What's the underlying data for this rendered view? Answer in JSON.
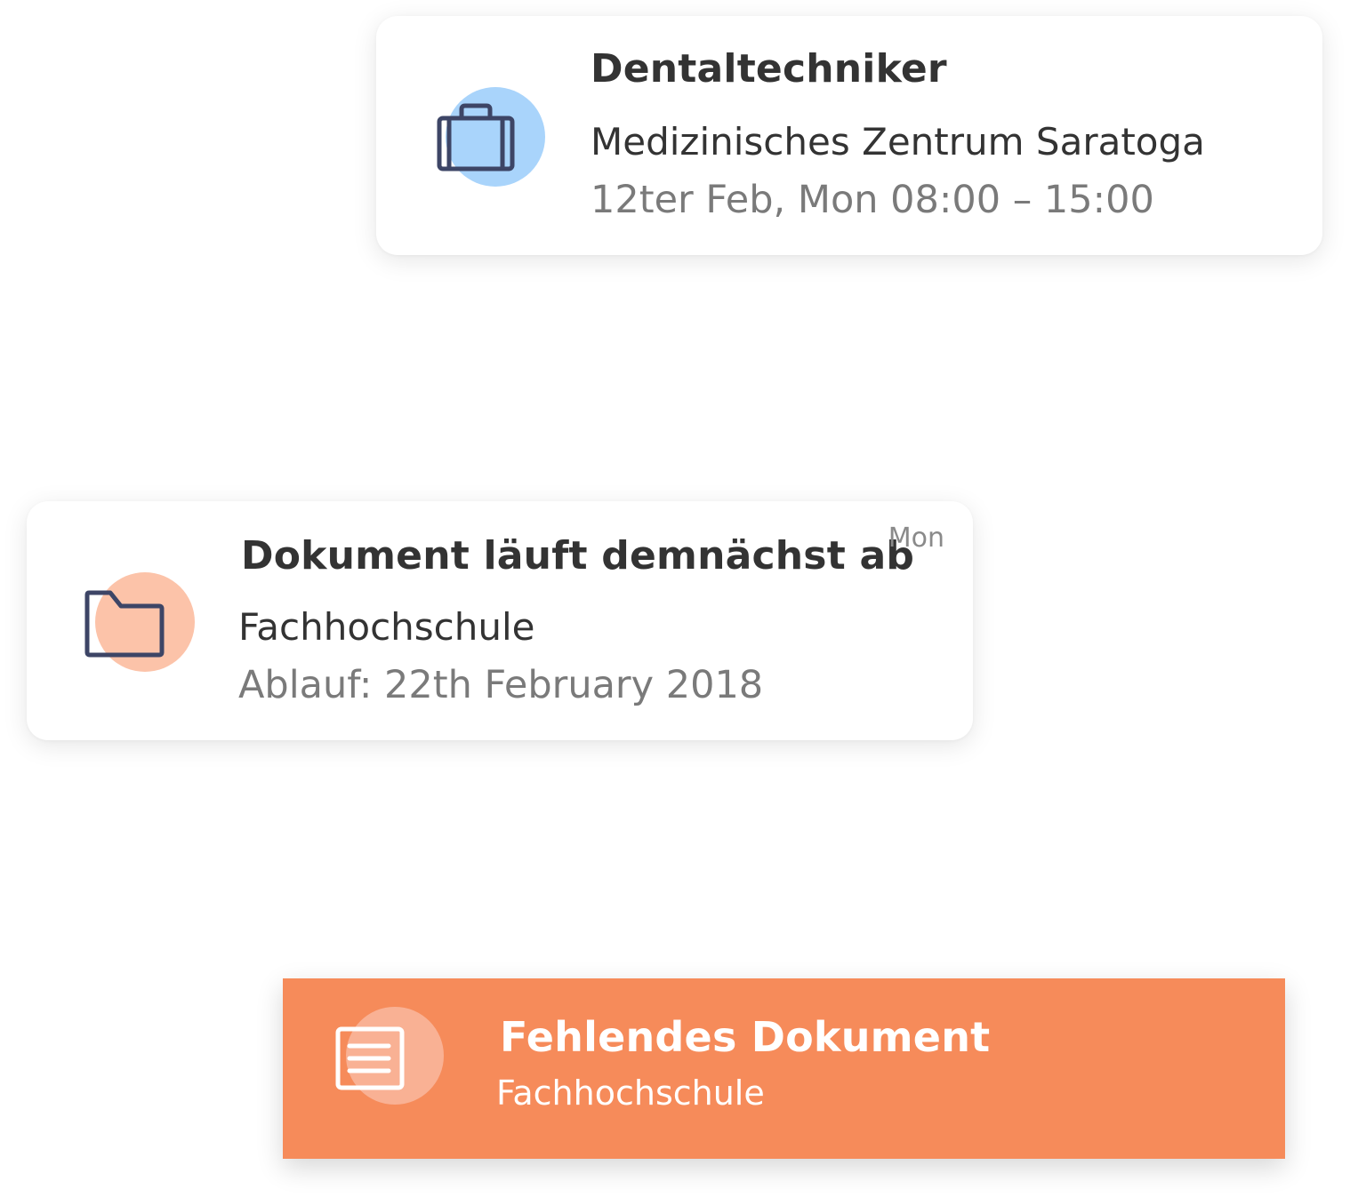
{
  "colors": {
    "page_background": "#ffffff",
    "card_background": "#ffffff",
    "title_text": "#333333",
    "secondary_text": "#7a7a7a",
    "icon_stroke": "#3d4566",
    "job_icon_blob": "#a9d4fb",
    "document_icon_blob": "#fcc3a9",
    "missing_card_background": "#f68b5a",
    "missing_icon_blob": "#f9b194",
    "missing_text": "#ffffff"
  },
  "notifications": [
    {
      "kind": "shift",
      "icon": "briefcase-icon",
      "title": "Dentaltechniker",
      "subtitle": "Medizinisches Zentrum Saratoga",
      "detail": "12ter Feb, Mon 08:00 – 15:00"
    },
    {
      "kind": "document-expiring",
      "icon": "folder-icon",
      "title": "Dokument läuft demnächst ab",
      "subtitle": "Fachhochschule",
      "detail": "Ablauf: 22th February 2018",
      "timestamp": "Mon"
    },
    {
      "kind": "document-missing",
      "icon": "document-icon",
      "title": "Fehlendes Dokument",
      "subtitle": "Fachhochschule"
    }
  ]
}
